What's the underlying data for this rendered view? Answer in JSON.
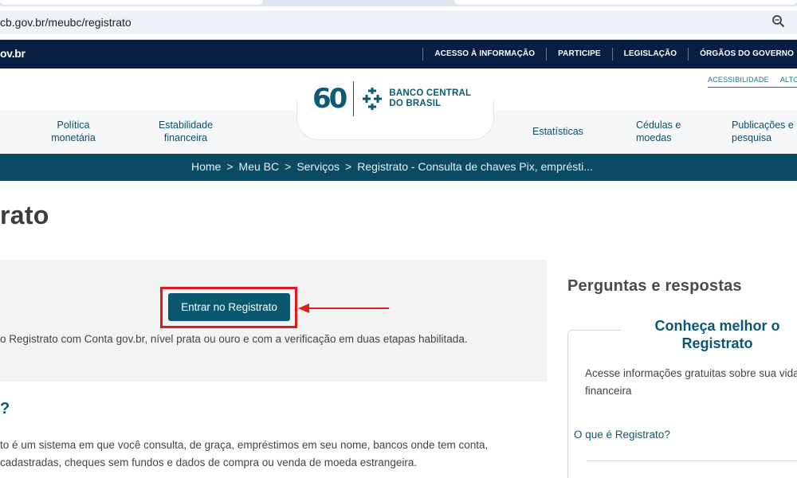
{
  "browser": {
    "url": "cb.gov.br/meubc/registrato"
  },
  "govbar": {
    "logo": "ov.br",
    "links": [
      "ACESSO À INFORMAÇÃO",
      "PARTICIPE",
      "LEGISLAÇÃO",
      "ÓRGÃOS DO GOVERNO"
    ]
  },
  "header": {
    "accessibility": [
      "ACESSIBILIDADE",
      "ALTO"
    ],
    "logo_number": "60",
    "logo_name_line1": "BANCO CENTRAL",
    "logo_name_line2": "DO BRASIL",
    "nav": [
      {
        "line1": "Política",
        "line2": "monetária"
      },
      {
        "line1": "Estabilidade",
        "line2": "financeira"
      },
      {
        "line1": "Estatísticas",
        "line2": ""
      },
      {
        "line1": "Cédulas e",
        "line2": "moedas"
      },
      {
        "line1": "Publicações e",
        "line2": "pesquisa"
      }
    ]
  },
  "breadcrumb": [
    "Home",
    "Meu BC",
    "Serviços",
    "Registrato - Consulta de chaves Pix, emprésti..."
  ],
  "breadcrumb_separator": ">",
  "page": {
    "title": "rato",
    "enter_button": "Entrar no Registrato",
    "login_note": "o Registrato com Conta gov.br, nível prata ou ouro e com a verificação em duas etapas habilitada.",
    "question_title": "?",
    "description_line1": "to é um sistema em que você consulta, de graça, empréstimos em seu nome, bancos onde tem conta,",
    "description_line2": "cadastradas, cheques sem fundos e dados de compra ou venda de moeda estrangeira."
  },
  "sidebar": {
    "title": "Perguntas e respostas",
    "card_title": "Conheça melhor o Registrato",
    "card_text": "Acesse informações gratuitas sobre sua vida financeira",
    "card_link": "O que é Registrato?"
  },
  "colors": {
    "gov_navy": "#071d41",
    "bc_teal": "#0a5870",
    "highlight_red": "#e01a1a"
  }
}
